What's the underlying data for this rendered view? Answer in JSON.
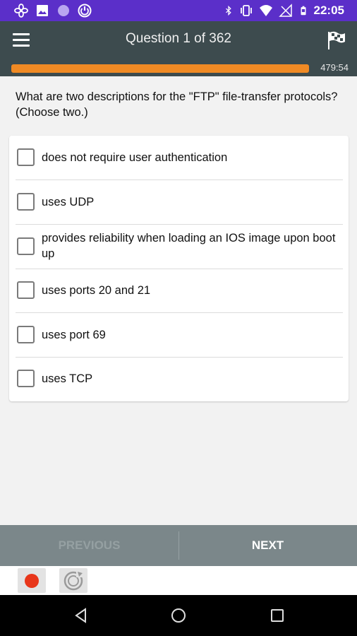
{
  "status_bar": {
    "time": "22:05",
    "left_icons": [
      "fan-icon",
      "image-icon",
      "circle-icon",
      "power-icon"
    ],
    "right_icons": [
      "bluetooth-icon",
      "vibrate-icon",
      "wifi-icon",
      "no-signal-icon",
      "battery-icon"
    ]
  },
  "app_bar": {
    "title": "Question 1 of 362",
    "menu_icon": "hamburger-menu-icon",
    "flag_icon": "checkered-flag-icon"
  },
  "progress": {
    "fraction": 1.0,
    "timer": "479:54",
    "accent": "#f08a24"
  },
  "question": {
    "text": "What are two descriptions for the \"FTP\" file-transfer protocols? (Choose two.)"
  },
  "options": [
    {
      "label": "does not require user authentication",
      "checked": false
    },
    {
      "label": "uses UDP",
      "checked": false
    },
    {
      "label": "provides reliability when loading an IOS image upon boot up",
      "checked": false
    },
    {
      "label": "uses ports 20 and 21",
      "checked": false
    },
    {
      "label": "uses port 69",
      "checked": false
    },
    {
      "label": "uses TCP",
      "checked": false
    }
  ],
  "nav": {
    "previous_label": "PREVIOUS",
    "next_label": "NEXT"
  },
  "toolstrip": {
    "icons": [
      "record-icon",
      "replay-icon"
    ]
  },
  "system_nav": {
    "icons": [
      "back-icon",
      "home-icon",
      "recents-icon"
    ]
  },
  "colors": {
    "status_bar": "#5b2fc9",
    "app_bar": "#3d4b4e",
    "nav_bar": "#7b878a",
    "record": "#e8361a"
  }
}
